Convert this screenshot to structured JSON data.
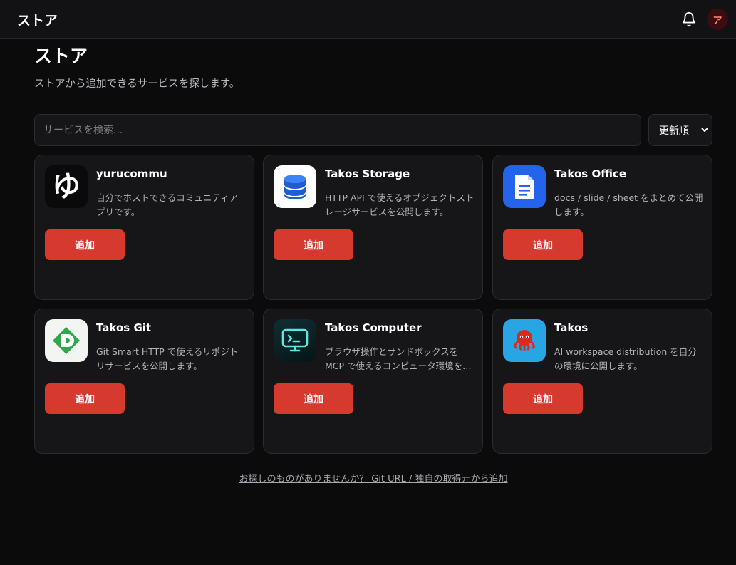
{
  "header": {
    "app_title": "ストア",
    "avatar_letter": "ア"
  },
  "main": {
    "title": "ストア",
    "subtitle": "ストアから追加できるサービスを探します。",
    "search_placeholder": "サービスを検索...",
    "sort_label": "更新順"
  },
  "services": [
    {
      "name": "yurucommu",
      "description": "自分でホストできるコミュニティアプリです。",
      "add_label": "追加",
      "icon": "yurucommu-yu-icon",
      "icon_glyph": "ゆ"
    },
    {
      "name": "Takos Storage",
      "description": "HTTP API で使えるオブジェクトストレージサービスを公開します。",
      "add_label": "追加",
      "icon": "database-icon"
    },
    {
      "name": "Takos Office",
      "description": "docs / slide / sheet をまとめて公開します。",
      "add_label": "追加",
      "icon": "document-icon"
    },
    {
      "name": "Takos Git",
      "description": "Git Smart HTTP で使えるリポジトリサービスを公開します。",
      "add_label": "追加",
      "icon": "git-logo-icon"
    },
    {
      "name": "Takos Computer",
      "description": "ブラウザ操作とサンドボックスを MCP で使えるコンピュータ環境を公開します。",
      "add_label": "追加",
      "icon": "terminal-monitor-icon"
    },
    {
      "name": "Takos",
      "description": "AI workspace distribution を自分の環境に公開します。",
      "add_label": "追加",
      "icon": "takos-octopus-icon"
    }
  ],
  "footer": {
    "link_text": "お探しのものがありませんか？ Git URL / 独自の取得元から追加"
  },
  "colors": {
    "accent": "#d63a2f",
    "background": "#0b0b0c",
    "card": "#161618"
  }
}
